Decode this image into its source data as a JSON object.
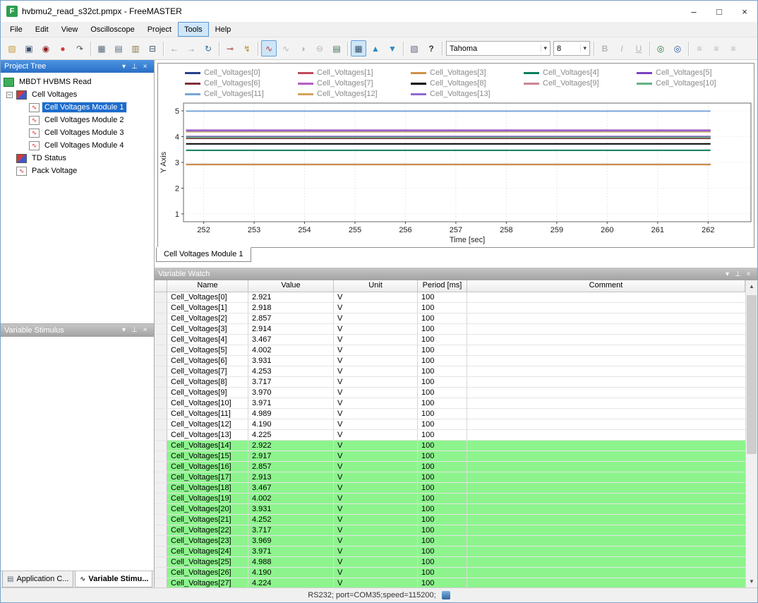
{
  "window": {
    "title": "hvbmu2_read_s32ct.pmpx - FreeMASTER",
    "logo_text": "F",
    "controls": {
      "minimize": "–",
      "maximize": "□",
      "close": "×"
    }
  },
  "menu": {
    "items": [
      "File",
      "Edit",
      "View",
      "Oscilloscope",
      "Project",
      "Tools",
      "Help"
    ],
    "active_index": 5
  },
  "panel_icons": {
    "menu": "▾",
    "pin": "⊥",
    "close": "×"
  },
  "scrollbar": {
    "up": "▲",
    "down": "▼"
  },
  "toolbar": {
    "items": [
      {
        "type": "button",
        "name": "open-project-button",
        "glyph": "▨",
        "color": "#c79a3b"
      },
      {
        "type": "button",
        "name": "save-project-button",
        "glyph": "▣",
        "color": "#3c4f6e"
      },
      {
        "type": "button",
        "name": "stop-communication-button",
        "glyph": "◉",
        "color": "#8d1f1f"
      },
      {
        "type": "button",
        "name": "record-stop-button",
        "glyph": "●",
        "color": "#d43c3c"
      },
      {
        "type": "button",
        "name": "reload-symbols-button",
        "glyph": "↷",
        "color": "#555555"
      },
      {
        "type": "sep"
      },
      {
        "type": "button",
        "name": "project-blocks-button",
        "glyph": "▦",
        "color": "#5a6b7c"
      },
      {
        "type": "button",
        "name": "copy-button",
        "glyph": "▤",
        "color": "#5a6b7c"
      },
      {
        "type": "button",
        "name": "paste-button",
        "glyph": "▥",
        "color": "#8a7a4a"
      },
      {
        "type": "button",
        "name": "print-button",
        "glyph": "⊟",
        "color": "#445566"
      },
      {
        "type": "sep"
      },
      {
        "type": "button",
        "name": "back-button",
        "glyph": "←",
        "color": "#8a8a8a"
      },
      {
        "type": "button",
        "name": "forward-button",
        "glyph": "→",
        "color": "#8a8a8a"
      },
      {
        "type": "button",
        "name": "refresh-button",
        "glyph": "↻",
        "color": "#2f6f9f"
      },
      {
        "type": "sep"
      },
      {
        "type": "button",
        "name": "connection-wizard-button",
        "glyph": "⊸",
        "color": "#a03030"
      },
      {
        "type": "button",
        "name": "communication-button",
        "glyph": "↯",
        "color": "#c08a20"
      },
      {
        "type": "sep"
      },
      {
        "type": "button",
        "name": "new-oscilloscope-button",
        "glyph": "∿",
        "color": "#c03030",
        "active": true
      },
      {
        "type": "button",
        "name": "close-oscilloscope-button",
        "glyph": "∿",
        "color": "#9a9a9a",
        "disabled": true
      },
      {
        "type": "button",
        "name": "new-recorder-button",
        "glyph": "◑",
        "color": "#9a9a9a",
        "disabled": true
      },
      {
        "type": "button",
        "name": "zoom-out-button",
        "glyph": "⊖",
        "color": "#9a9a9a",
        "disabled": true
      },
      {
        "type": "button",
        "name": "copy-graph-button",
        "glyph": "▤",
        "color": "#3f6f4f"
      },
      {
        "type": "sep"
      },
      {
        "type": "button",
        "name": "grid-toggle-button",
        "glyph": "▦",
        "color": "#35506b",
        "active": true
      },
      {
        "type": "button",
        "name": "move-up-button",
        "glyph": "▲",
        "color": "#2e86c1"
      },
      {
        "type": "button",
        "name": "move-down-button",
        "glyph": "▼",
        "color": "#2e86c1"
      },
      {
        "type": "sep"
      },
      {
        "type": "button",
        "name": "properties-button",
        "glyph": "▧",
        "color": "#6b5b7b"
      },
      {
        "type": "button",
        "name": "context-help-button",
        "glyph": "?",
        "color": "#333333",
        "bold": true
      },
      {
        "type": "sep"
      },
      {
        "type": "combo",
        "name": "font-combo",
        "value": "Tahoma",
        "width": 148
      },
      {
        "type": "combo",
        "name": "size-combo",
        "value": "8",
        "width": 52
      },
      {
        "type": "sep"
      },
      {
        "type": "button",
        "name": "bold-button",
        "glyph": "B",
        "color": "#9a9a9a",
        "disabled": true,
        "bold": true
      },
      {
        "type": "button",
        "name": "italic-button",
        "glyph": "I",
        "color": "#9a9a9a",
        "disabled": true,
        "italic": true
      },
      {
        "type": "button",
        "name": "underline-button",
        "glyph": "U",
        "color": "#9a9a9a",
        "disabled": true,
        "underline": true
      },
      {
        "type": "sep"
      },
      {
        "type": "button",
        "name": "insert-link-button",
        "glyph": "◎",
        "color": "#2a7a3a"
      },
      {
        "type": "button",
        "name": "browse-web-button",
        "glyph": "◎",
        "color": "#2a5a9a"
      },
      {
        "type": "sep"
      },
      {
        "type": "button",
        "name": "align-left-button",
        "glyph": "≡",
        "color": "#9a9a9a",
        "disabled": true
      },
      {
        "type": "button",
        "name": "align-center-button",
        "glyph": "≡",
        "color": "#9a9a9a",
        "disabled": true
      },
      {
        "type": "button",
        "name": "align-right-button",
        "glyph": "≡",
        "color": "#9a9a9a",
        "disabled": true
      }
    ],
    "combo_arrow_glyph": "▾"
  },
  "project_tree": {
    "title": "Project Tree",
    "items": [
      {
        "label": "MBDT HVBMS Read",
        "depth": 0,
        "icon": "board"
      },
      {
        "label": "Cell Voltages",
        "depth": 1,
        "icon": "node",
        "expander": true
      },
      {
        "label": "Cell Voltages Module 1",
        "depth": 2,
        "icon": "scope",
        "selected": true
      },
      {
        "label": "Cell Voltages Module 2",
        "depth": 2,
        "icon": "scope"
      },
      {
        "label": "Cell Voltages Module 3",
        "depth": 2,
        "icon": "scope"
      },
      {
        "label": "Cell Voltages Module 4",
        "depth": 2,
        "icon": "scope"
      },
      {
        "label": "TD Status",
        "depth": 1,
        "icon": "node"
      },
      {
        "label": "Pack Voltage",
        "depth": 1,
        "icon": "scope"
      }
    ]
  },
  "variable_stimulus": {
    "title": "Variable Stimulus"
  },
  "sidebar_tabs": [
    {
      "label": "Application C...",
      "icon": "app-commands-icon",
      "active": false
    },
    {
      "label": "Variable Stimu...",
      "icon": "variable-stimulus-icon",
      "active": true
    }
  ],
  "scope_tab": {
    "label": "Cell Voltages Module 1"
  },
  "chart_data": {
    "type": "line",
    "title": "",
    "xlabel": "Time [sec]",
    "ylabel": "Y Axis",
    "xlim": [
      251.6,
      262.85
    ],
    "ylim": [
      0.7,
      5.3
    ],
    "x_ticks": [
      252,
      253,
      254,
      255,
      256,
      257,
      258,
      259,
      260,
      261,
      262
    ],
    "y_ticks": [
      1,
      2,
      3,
      4,
      5
    ],
    "grid": "dotted",
    "legend_position": "top",
    "line_x_start": 251.65,
    "line_x_end": 262.05,
    "series": [
      {
        "name": "Cell_Voltages[0]",
        "color": "#27408b",
        "value": 2.921
      },
      {
        "name": "Cell_Voltages[1]",
        "color": "#bf4a5e",
        "value": 2.918
      },
      {
        "name": "Cell_Voltages[3]",
        "color": "#cf9146",
        "value": 2.914
      },
      {
        "name": "Cell_Voltages[4]",
        "color": "#0e7d5e",
        "value": 3.467
      },
      {
        "name": "Cell_Voltages[5]",
        "color": "#7a42c3",
        "value": 4.002
      },
      {
        "name": "Cell_Voltages[6]",
        "color": "#823039",
        "value": 3.931
      },
      {
        "name": "Cell_Voltages[7]",
        "color": "#b45fc4",
        "value": 4.253
      },
      {
        "name": "Cell_Voltages[8]",
        "color": "#000000",
        "value": 3.717
      },
      {
        "name": "Cell_Voltages[9]",
        "color": "#cc8691",
        "value": 3.97
      },
      {
        "name": "Cell_Voltages[10]",
        "color": "#62b283",
        "value": 3.971
      },
      {
        "name": "Cell_Voltages[11]",
        "color": "#79a6d6",
        "value": 4.989
      },
      {
        "name": "Cell_Voltages[12]",
        "color": "#d2a45f",
        "value": 4.19
      },
      {
        "name": "Cell_Voltages[13]",
        "color": "#8f6bd0",
        "value": 4.225
      }
    ]
  },
  "variable_watch": {
    "title": "Variable Watch",
    "columns": [
      "Name",
      "Value",
      "Unit",
      "Period [ms]",
      "Comment"
    ],
    "rows": [
      {
        "name": "Cell_Voltages[0]",
        "value": "2.921",
        "unit": "V",
        "period": "100",
        "comment": "",
        "highlight": false
      },
      {
        "name": "Cell_Voltages[1]",
        "value": "2.918",
        "unit": "V",
        "period": "100",
        "comment": "",
        "highlight": false
      },
      {
        "name": "Cell_Voltages[2]",
        "value": "2.857",
        "unit": "V",
        "period": "100",
        "comment": "",
        "highlight": false
      },
      {
        "name": "Cell_Voltages[3]",
        "value": "2.914",
        "unit": "V",
        "period": "100",
        "comment": "",
        "highlight": false
      },
      {
        "name": "Cell_Voltages[4]",
        "value": "3.467",
        "unit": "V",
        "period": "100",
        "comment": "",
        "highlight": false
      },
      {
        "name": "Cell_Voltages[5]",
        "value": "4.002",
        "unit": "V",
        "period": "100",
        "comment": "",
        "highlight": false
      },
      {
        "name": "Cell_Voltages[6]",
        "value": "3.931",
        "unit": "V",
        "period": "100",
        "comment": "",
        "highlight": false
      },
      {
        "name": "Cell_Voltages[7]",
        "value": "4.253",
        "unit": "V",
        "period": "100",
        "comment": "",
        "highlight": false
      },
      {
        "name": "Cell_Voltages[8]",
        "value": "3.717",
        "unit": "V",
        "period": "100",
        "comment": "",
        "highlight": false
      },
      {
        "name": "Cell_Voltages[9]",
        "value": "3.970",
        "unit": "V",
        "period": "100",
        "comment": "",
        "highlight": false
      },
      {
        "name": "Cell_Voltages[10]",
        "value": "3.971",
        "unit": "V",
        "period": "100",
        "comment": "",
        "highlight": false
      },
      {
        "name": "Cell_Voltages[11]",
        "value": "4.989",
        "unit": "V",
        "period": "100",
        "comment": "",
        "highlight": false
      },
      {
        "name": "Cell_Voltages[12]",
        "value": "4.190",
        "unit": "V",
        "period": "100",
        "comment": "",
        "highlight": false
      },
      {
        "name": "Cell_Voltages[13]",
        "value": "4.225",
        "unit": "V",
        "period": "100",
        "comment": "",
        "highlight": false
      },
      {
        "name": "Cell_Voltages[14]",
        "value": "2.922",
        "unit": "V",
        "period": "100",
        "comment": "",
        "highlight": true
      },
      {
        "name": "Cell_Voltages[15]",
        "value": "2.917",
        "unit": "V",
        "period": "100",
        "comment": "",
        "highlight": true
      },
      {
        "name": "Cell_Voltages[16]",
        "value": "2.857",
        "unit": "V",
        "period": "100",
        "comment": "",
        "highlight": true
      },
      {
        "name": "Cell_Voltages[17]",
        "value": "2.913",
        "unit": "V",
        "period": "100",
        "comment": "",
        "highlight": true
      },
      {
        "name": "Cell_Voltages[18]",
        "value": "3.467",
        "unit": "V",
        "period": "100",
        "comment": "",
        "highlight": true
      },
      {
        "name": "Cell_Voltages[19]",
        "value": "4.002",
        "unit": "V",
        "period": "100",
        "comment": "",
        "highlight": true
      },
      {
        "name": "Cell_Voltages[20]",
        "value": "3.931",
        "unit": "V",
        "period": "100",
        "comment": "",
        "highlight": true
      },
      {
        "name": "Cell_Voltages[21]",
        "value": "4.252",
        "unit": "V",
        "period": "100",
        "comment": "",
        "highlight": true
      },
      {
        "name": "Cell_Voltages[22]",
        "value": "3.717",
        "unit": "V",
        "period": "100",
        "comment": "",
        "highlight": true
      },
      {
        "name": "Cell_Voltages[23]",
        "value": "3.969",
        "unit": "V",
        "period": "100",
        "comment": "",
        "highlight": true
      },
      {
        "name": "Cell_Voltages[24]",
        "value": "3.971",
        "unit": "V",
        "period": "100",
        "comment": "",
        "highlight": true
      },
      {
        "name": "Cell_Voltages[25]",
        "value": "4.988",
        "unit": "V",
        "period": "100",
        "comment": "",
        "highlight": true
      },
      {
        "name": "Cell_Voltages[26]",
        "value": "4.190",
        "unit": "V",
        "period": "100",
        "comment": "",
        "highlight": true
      },
      {
        "name": "Cell_Voltages[27]",
        "value": "4.224",
        "unit": "V",
        "period": "100",
        "comment": "",
        "highlight": true
      }
    ]
  },
  "status_bar": {
    "text": "RS232; port=COM35;speed=115200;"
  },
  "colors": {
    "highlight_green": "#8df48d",
    "selection_blue": "#1d6ccc",
    "active_panel_header": "#2a6ec6"
  }
}
